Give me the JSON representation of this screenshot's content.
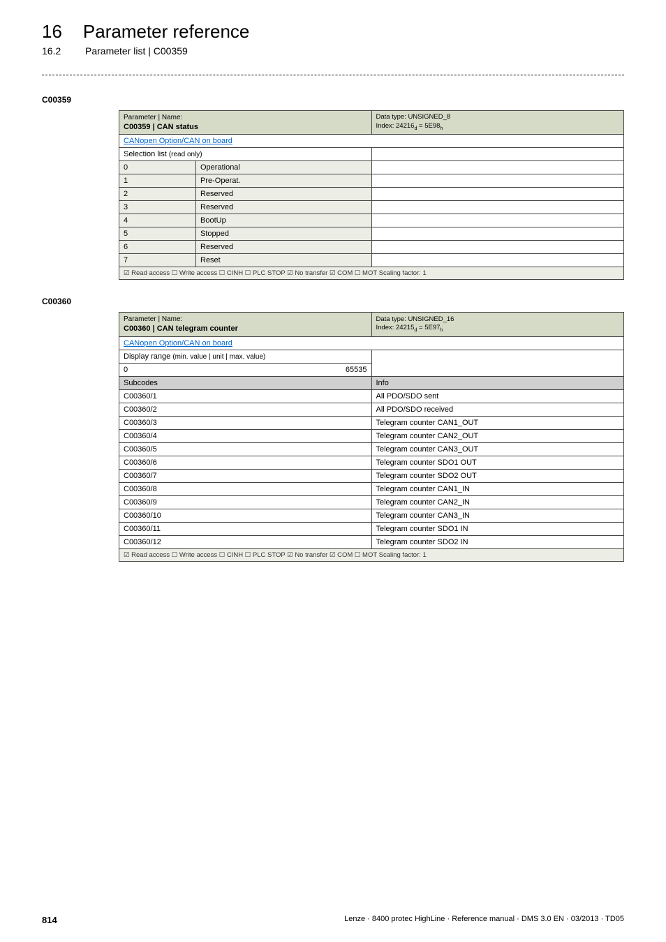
{
  "header": {
    "chapnum": "16",
    "chaptitle": "Parameter reference",
    "secnum": "16.2",
    "sectitle": "Parameter list | C00359"
  },
  "block1": {
    "code": "C00359",
    "pn_l1": "Parameter | Name:",
    "pn_l2": "C00359 | CAN status",
    "dtype_l1": "Data type: UNSIGNED_8",
    "dtype_l2": "Index: 24216d = 5E98h",
    "link_tri": "",
    "link_text": "CANopen Option/CAN on board",
    "sel_head": "Selection list",
    "sel_head_small": "(read only)",
    "rows": [
      {
        "n": "0",
        "v": "Operational"
      },
      {
        "n": "1",
        "v": "Pre-Operat."
      },
      {
        "n": "2",
        "v": "Reserved"
      },
      {
        "n": "3",
        "v": "Reserved"
      },
      {
        "n": "4",
        "v": "BootUp"
      },
      {
        "n": "5",
        "v": "Stopped"
      },
      {
        "n": "6",
        "v": "Reserved"
      },
      {
        "n": "7",
        "v": "Reset"
      }
    ],
    "access": "☑ Read access   ☐ Write access   ☐ CINH   ☐ PLC STOP   ☑ No transfer   ☑ COM   ☐ MOT    Scaling factor: 1"
  },
  "block2": {
    "code": "C00360",
    "pn_l1": "Parameter | Name:",
    "pn_l2": "C00360 | CAN telegram counter",
    "dtype_l1": "Data type: UNSIGNED_16",
    "dtype_l2": "Index: 24215d = 5E97h",
    "link_tri": "",
    "link_text": "CANopen Option/CAN on board",
    "disp_head": "Display range",
    "disp_head_small": "(min. value | unit | max. value)",
    "range_min": "0",
    "range_max": "65535",
    "subcodes_l": "Subcodes",
    "subcodes_r": "Info",
    "rows": [
      {
        "c": "C00360/1",
        "i": "All PDO/SDO sent"
      },
      {
        "c": "C00360/2",
        "i": "All PDO/SDO received"
      },
      {
        "c": "C00360/3",
        "i": "Telegram counter CAN1_OUT"
      },
      {
        "c": "C00360/4",
        "i": "Telegram counter CAN2_OUT"
      },
      {
        "c": "C00360/5",
        "i": "Telegram counter CAN3_OUT"
      },
      {
        "c": "C00360/6",
        "i": "Telegram counter SDO1 OUT"
      },
      {
        "c": "C00360/7",
        "i": "Telegram counter SDO2 OUT"
      },
      {
        "c": "C00360/8",
        "i": "Telegram counter CAN1_IN"
      },
      {
        "c": "C00360/9",
        "i": "Telegram counter CAN2_IN"
      },
      {
        "c": "C00360/10",
        "i": "Telegram counter CAN3_IN"
      },
      {
        "c": "C00360/11",
        "i": "Telegram counter SDO1 IN"
      },
      {
        "c": "C00360/12",
        "i": "Telegram counter SDO2 IN"
      }
    ],
    "access": "☑ Read access   ☐ Write access   ☐ CINH   ☐ PLC STOP   ☑ No transfer   ☑ COM   ☐ MOT    Scaling factor: 1"
  },
  "footer": {
    "page": "814",
    "ref": "Lenze · 8400 protec HighLine · Reference manual · DMS 3.0 EN · 03/2013 · TD05"
  }
}
